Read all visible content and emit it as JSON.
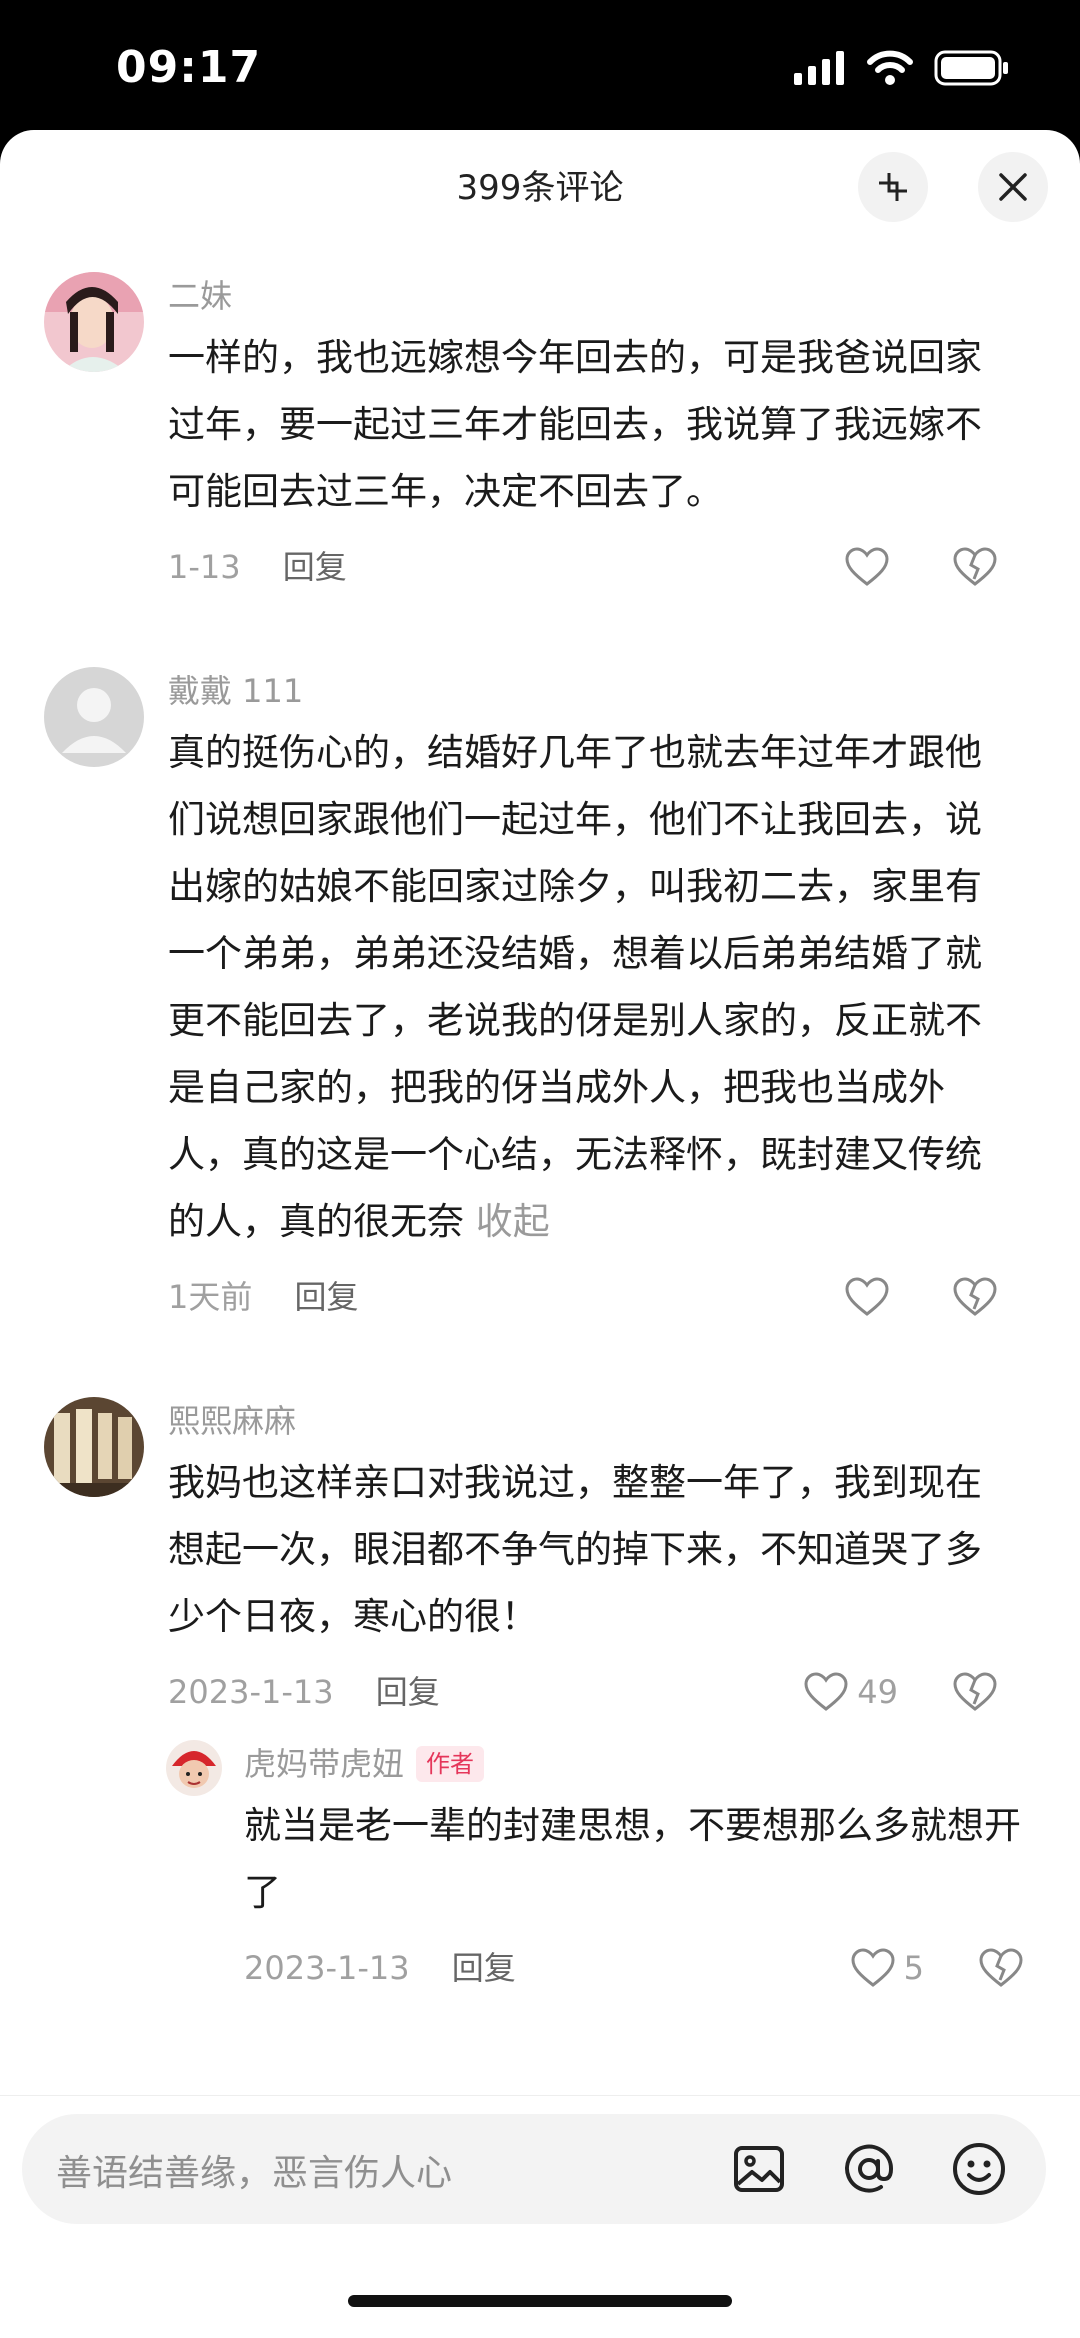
{
  "status_bar": {
    "time": "09:17"
  },
  "header": {
    "title": "399条评论"
  },
  "comments": [
    {
      "username": "二妹",
      "text": "一样的，我也远嫁想今年回去的，可是我爸说回家过年，要一起过三年才能回去，我说算了我远嫁不可能回去过三年，决定不回去了。",
      "date": "1-13",
      "reply_label": "回复",
      "likes": ""
    },
    {
      "username": "戴戴 111",
      "text": "真的挺伤心的，结婚好几年了也就去年过年才跟他们说想回家跟他们一起过年，他们不让我回去，说出嫁的姑娘不能回家过除夕，叫我初二去，家里有一个弟弟，弟弟还没结婚，想着以后弟弟结婚了就更不能回去了，老说我的伢是别人家的，反正就不是自己家的，把我的伢当成外人，把我也当成外人，真的这是一个心结，无法释怀，既封建又传统的人，真的很无奈",
      "collapse_label": "收起",
      "date": "1天前",
      "reply_label": "回复",
      "likes": ""
    },
    {
      "username": "熙熙麻麻",
      "text": "我妈也这样亲口对我说过，整整一年了，我到现在想起一次，眼泪都不争气的掉下来，不知道哭了多少个日夜，寒心的很！",
      "date": "2023-1-13",
      "reply_label": "回复",
      "likes": "49"
    }
  ],
  "reply": {
    "username": "虎妈带虎妞",
    "author_tag": "作者",
    "text": "就当是老一辈的封建思想，不要想那么多就想开了",
    "date": "2023-1-13",
    "reply_label": "回复",
    "likes": "5"
  },
  "input": {
    "placeholder": "善语结善缘，恶言伤人心"
  },
  "colors": {
    "accent": "#e5365a",
    "muted": "#9a9a9a",
    "text": "#1b1b1b"
  }
}
